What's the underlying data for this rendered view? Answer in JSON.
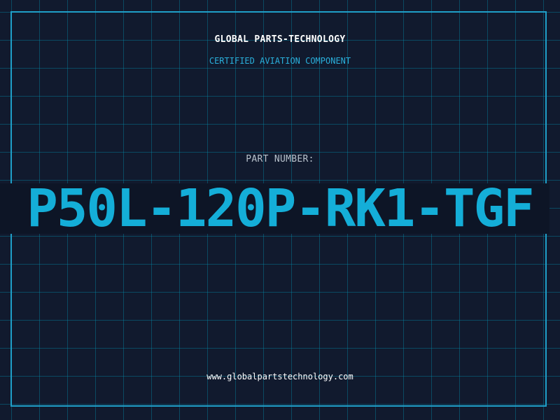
{
  "header": {
    "company_name": "GLOBAL PARTS-TECHNOLOGY",
    "subtitle": "CERTIFIED AVIATION COMPONENT"
  },
  "part": {
    "label": "PART NUMBER:",
    "number": "P50L-120P-RK1-TGF"
  },
  "footer": {
    "website": "www.globalpartstechnology.com"
  },
  "colors": {
    "background": "#111a2e",
    "grid": "#0096b4",
    "frame": "#1f9fc8",
    "accent": "#14aed8",
    "text": "#ffffff",
    "muted": "#b8c2cc"
  }
}
